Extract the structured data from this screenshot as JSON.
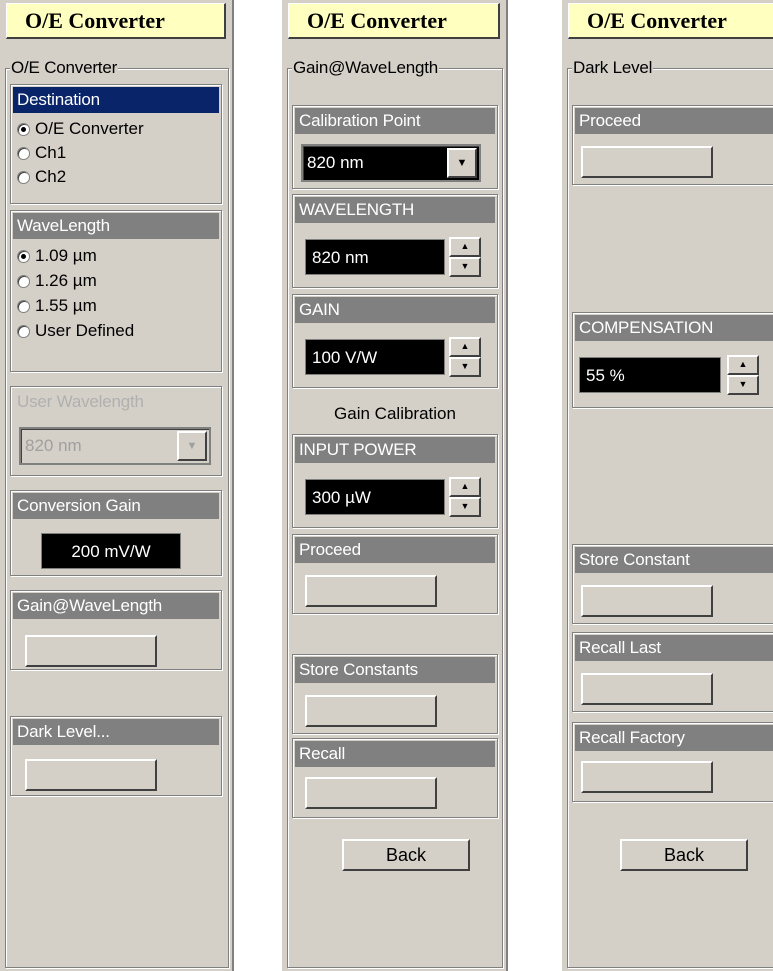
{
  "panel1": {
    "title": "O/E Converter",
    "frame_label": "O/E Converter",
    "destination": {
      "header": "Destination",
      "options": [
        "O/E Converter",
        "Ch1",
        "Ch2"
      ],
      "selected": "O/E Converter"
    },
    "wavelength": {
      "header": "WaveLength",
      "options": [
        "1.09 µm",
        "1.26 µm",
        "1.55 µm",
        "User Defined"
      ],
      "selected": "1.09 µm"
    },
    "user_wavelength": {
      "header": "User Wavelength",
      "value": "820 nm",
      "enabled": false
    },
    "conversion_gain": {
      "header": "Conversion Gain",
      "value": "200 mV/W"
    },
    "gain_at_wavelength": {
      "header": "Gain@WaveLength",
      "button_label": ""
    },
    "dark_level": {
      "header": "Dark Level...",
      "button_label": ""
    }
  },
  "panel2": {
    "title": "O/E Converter",
    "frame_label": "Gain@WaveLength",
    "calibration_point": {
      "header": "Calibration Point",
      "value": "820 nm"
    },
    "wavelength": {
      "header": "WAVELENGTH",
      "value": "820 nm"
    },
    "gain": {
      "header": "GAIN",
      "value": "100 V/W"
    },
    "gain_calibration_label": "Gain Calibration",
    "input_power": {
      "header": "INPUT POWER",
      "value": "300 µW"
    },
    "proceed": {
      "header": "Proceed",
      "button_label": ""
    },
    "store_constants": {
      "header": "Store Constants",
      "button_label": ""
    },
    "recall": {
      "header": "Recall",
      "button_label": ""
    },
    "back_label": "Back"
  },
  "panel3": {
    "title": "O/E Converter",
    "frame_label": "Dark Level",
    "proceed": {
      "header": "Proceed",
      "button_label": ""
    },
    "compensation": {
      "header": "COMPENSATION",
      "value": "55 %"
    },
    "store_constant": {
      "header": "Store Constant",
      "button_label": ""
    },
    "recall_last": {
      "header": "Recall Last",
      "button_label": ""
    },
    "recall_factory": {
      "header": "Recall Factory",
      "button_label": ""
    },
    "back_label": "Back"
  },
  "icons": {
    "spin_up": "▲",
    "spin_down": "▼",
    "combo_arrow": "▼"
  },
  "colors": {
    "title_bg": "#ffffc0",
    "panel_bg": "#d4d0c8",
    "group_header_bg": "#808080",
    "selected_header_bg": "#0a246a",
    "value_box_bg": "#000000"
  }
}
